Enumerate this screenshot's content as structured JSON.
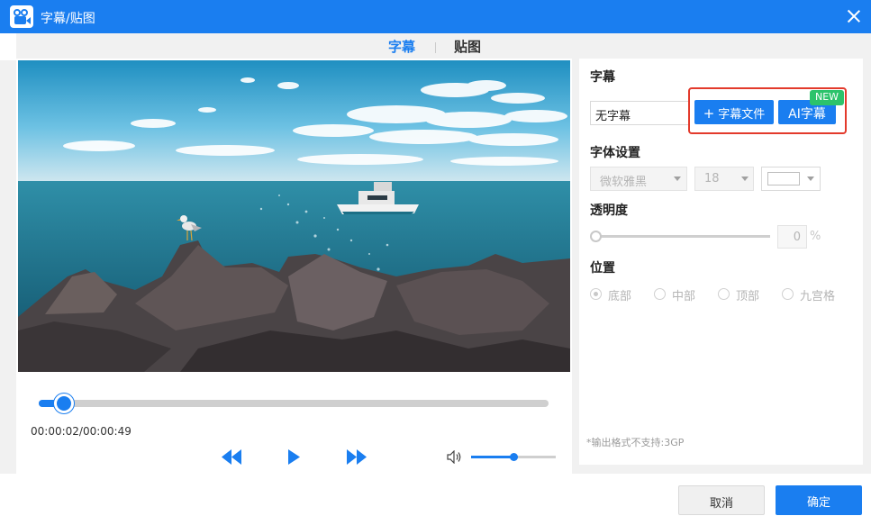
{
  "window": {
    "title": "字幕/贴图"
  },
  "tabs": {
    "subtitle": "字幕",
    "sticker": "贴图"
  },
  "player": {
    "time": "00:00:02/00:00:49",
    "progress": 0.05,
    "volume": 0.5
  },
  "subtitle_section": {
    "title": "字幕",
    "select_value": "无字幕",
    "add_file_label": "字幕文件",
    "add_file_icon": "plus-icon",
    "ai_label": "AI字幕",
    "new_badge": "NEW"
  },
  "font_section": {
    "title": "字体设置",
    "font_value": "微软雅黑",
    "size_value": "18",
    "color_value": "#ffffff"
  },
  "opacity_section": {
    "title": "透明度",
    "value": "0",
    "unit": "%"
  },
  "position_section": {
    "title": "位置",
    "options": [
      "底部",
      "中部",
      "顶部",
      "九宫格"
    ],
    "selected": "底部"
  },
  "note": "*输出格式不支持:3GP",
  "footer": {
    "cancel": "取消",
    "ok": "确定"
  },
  "colors": {
    "accent": "#1a7ef0",
    "highlight": "#e33a2c",
    "badge": "#2cc36b"
  }
}
